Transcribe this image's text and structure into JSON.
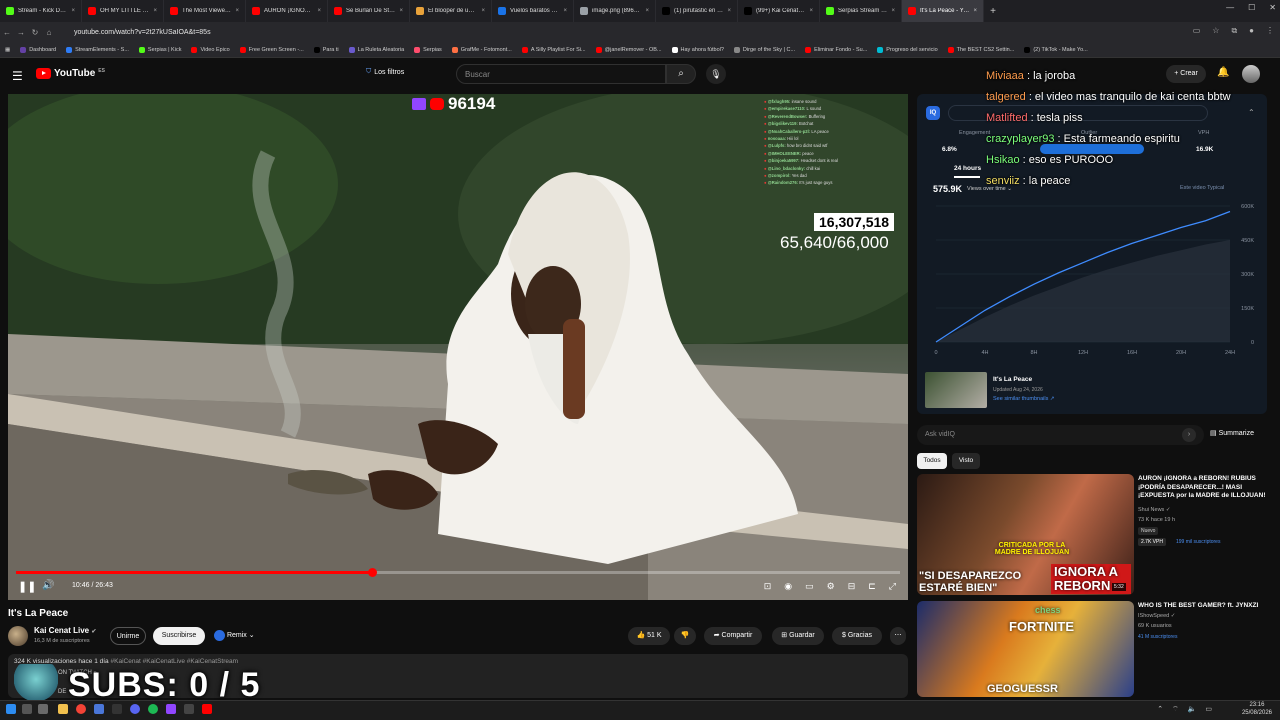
{
  "browser": {
    "tabs": [
      {
        "label": "Stream - Kick Dashbo",
        "color": "#53fc18"
      },
      {
        "label": "OH MY LITTLE BABY B",
        "color": "#ff0000"
      },
      {
        "label": "The Most Viewed VO",
        "color": "#ff0000"
      },
      {
        "label": "AURON ¡IGNORA a RE",
        "color": "#ff0000"
      },
      {
        "label": "Se Burlan De Stream",
        "color": "#ff0000"
      },
      {
        "label": "El blooper de un stre",
        "color": "#e8a23a"
      },
      {
        "label": "Vuelos baratos de Bar",
        "color": "#1a73e8"
      },
      {
        "label": "image.png (896×1024)",
        "color": "#9aa0a6"
      },
      {
        "label": "(1) pirutastic en X: \"so",
        "color": "#000000"
      },
      {
        "label": "(99+) Kai Cenat La Pea",
        "color": "#000000"
      },
      {
        "label": "Serpias Stream - Watc",
        "color": "#53fc18"
      },
      {
        "label": "It's La Peace - YouTu",
        "color": "#ff0000",
        "active": true
      }
    ],
    "url": "youtube.com/watch?v=2t27kUSaIOA&t=85s",
    "bookmarks": [
      {
        "label": "Dashboard",
        "color": "#6441a5"
      },
      {
        "label": "StreamElements - S...",
        "color": "#2e7cf6"
      },
      {
        "label": "Serpias | Kick",
        "color": "#53fc18"
      },
      {
        "label": "Video Epico",
        "color": "#ff0000"
      },
      {
        "label": "Free Green Screen -...",
        "color": "#ff0000"
      },
      {
        "label": "Para ti",
        "color": "#000000"
      },
      {
        "label": "La Ruleta Aleatoria",
        "color": "#6a5acd"
      },
      {
        "label": "Serpias",
        "color": "#ff4d6d"
      },
      {
        "label": "GrafMe - Fotomont...",
        "color": "#ff7043"
      },
      {
        "label": "A Silly Playlist For Si...",
        "color": "#ff0000"
      },
      {
        "label": "@janelRemover - OB...",
        "color": "#ff0000"
      },
      {
        "label": "Hay ahora fútbol?",
        "color": "#ffffff"
      },
      {
        "label": "Dirge of the Sky | C...",
        "color": "#888888"
      },
      {
        "label": "Eliminar Fondo - Su...",
        "color": "#ff0000"
      },
      {
        "label": "Progreso del servicio",
        "color": "#00bcd4"
      },
      {
        "label": "The BEST CS2 Settin...",
        "color": "#ff0000"
      },
      {
        "label": "(2) TikTok - Make Yo...",
        "color": "#000000"
      }
    ]
  },
  "youtube": {
    "logo_text": "YouTube",
    "logo_cc": "ES",
    "filters_label": "Los filtros",
    "search_placeholder": "Buscar",
    "create_label": "Crear"
  },
  "player": {
    "viewer_count": "96194",
    "stat_box": "16,307,518",
    "stat_progress": "65,640/66,000",
    "time": "10:46 / 26:43",
    "progress_fraction": 0.403,
    "chat_overlay": [
      {
        "user": "@fxlugh95:",
        "msg": "insane sound"
      },
      {
        "user": "@empirekase7110:",
        "msg": "L sound"
      },
      {
        "user": "@ReverendBowser:",
        "msg": "Buffering"
      },
      {
        "user": "@bigslikev119:",
        "msg": "Botchat"
      },
      {
        "user": "@NoahCaballero-p2l:",
        "msg": "LA peace"
      },
      {
        "user": "nosoaaa:",
        "msg": "Hiii lol"
      },
      {
        "user": "@Lulpfs:",
        "msg": "how bro didnt said wtf"
      },
      {
        "user": "@IMHOLEENER:",
        "msg": "peace"
      },
      {
        "user": "@binjoeka5997:",
        "msg": "Headset dont is real"
      },
      {
        "user": "@Lino_bdaclonky:",
        "msg": "chill kai"
      },
      {
        "user": "@zompirol:",
        "msg": "Yes dad"
      },
      {
        "user": "@Raindom276:",
        "msg": "It's just sage guys"
      }
    ]
  },
  "video": {
    "title": "It's La Peace",
    "channel": "Kai Cenat Live",
    "channel_subs": "16,3 M de suscriptores",
    "join_label": "Unirme",
    "subscribe_label": "Suscribirse",
    "remix_label": "Remix",
    "likes": "51 K",
    "share_label": "Compartir",
    "save_label": "Guardar",
    "thanks_label": "Gracias",
    "desc_meta": "324 K visualizaciones  hace 1 día",
    "desc_tags": "#KaiCenat #KaiCenatLive #KaiCenatStream",
    "desc_line2": "ON TWITCH »",
    "desc_line3": "DE",
    "subs_overlay": "SUBS: 0 / 5"
  },
  "vidiq": {
    "logo": "IQ",
    "stats_labels": [
      "Engagement",
      "Outlier",
      "VPH"
    ],
    "stats_values": [
      "6.8%",
      "",
      "16.9K"
    ],
    "tab_label": "24 hours",
    "big_views": "575.9K",
    "views_over": "Views over time ⌄",
    "legend": "Este video   Typical",
    "y_ticks": [
      "600K",
      "450K",
      "300K",
      "150K",
      "0"
    ],
    "x_ticks": [
      "0",
      "4H",
      "8H",
      "12H",
      "16H",
      "20H",
      "24H"
    ],
    "ref_title": "It's La Peace",
    "ref_date": "Updated Aug 24, 2026",
    "ref_link": "See similar thumbnails ↗"
  },
  "chart_data": {
    "type": "line",
    "title": "Views over time",
    "x": [
      0,
      2,
      4,
      6,
      8,
      10,
      12,
      14,
      16,
      18,
      20,
      22,
      24
    ],
    "x_tick_labels": [
      "0",
      "4H",
      "8H",
      "12H",
      "16H",
      "20H",
      "24H"
    ],
    "y_tick_labels": [
      "0",
      "150K",
      "300K",
      "450K",
      "600K"
    ],
    "ylim": [
      0,
      600000
    ],
    "xlim": [
      0,
      24
    ],
    "series": [
      {
        "name": "Este video",
        "values": [
          0,
          70000,
          140000,
          200000,
          255000,
          305000,
          350000,
          395000,
          435000,
          470000,
          505000,
          535000,
          575900
        ],
        "color": "#3f8cff"
      },
      {
        "name": "Typical",
        "values": [
          0,
          55000,
          110000,
          160000,
          205000,
          245000,
          285000,
          320000,
          350000,
          380000,
          405000,
          430000,
          450000
        ],
        "color": "#3a4350"
      }
    ]
  },
  "stream_chat": [
    {
      "user": "Miviaaa",
      "msg": " : la joroba",
      "cls": "or"
    },
    {
      "user": "talgered",
      "msg": " : el video mas tranquilo de kai centa bbtw",
      "cls": "or"
    },
    {
      "user": "Matlifted",
      "msg": " : tesla piss",
      "cls": "pk"
    },
    {
      "user": "crazyplayer93",
      "msg": " : Esta farmeando espiritu",
      "cls": ""
    },
    {
      "user": "Hsikao",
      "msg": " : eso es PUROOO",
      "cls": ""
    },
    {
      "user": "senviiz",
      "msg": " : la peace",
      "cls": "yl"
    }
  ],
  "sidebar": {
    "ask_placeholder": "Ask vidIQ",
    "summarize_label": "Summarize",
    "chip_all": "Todos",
    "chip_seen": "Visto",
    "recs": [
      {
        "title": "AURON ¡IGNORA a REBORN! RUBIUS ¡PODRÍA DESAPARECER...! MASI ¡EXPUESTA por la MADRE de ILLOJUAN!",
        "channel": "Shui News ✓",
        "views": "73 K  hace 19 h",
        "badge": "Nuevo",
        "vph": "2.7K VPH",
        "subs": "199 mil suscriptores",
        "duration": "5:32",
        "thumb_text1": "CRITICADA POR LA MADRE DE ILLOJUAN",
        "thumb_text2": "\"SI DESAPAREZCO ESTARÉ BIEN\"",
        "thumb_text3": "IGNORA A REBORN"
      },
      {
        "title": "WHO IS THE BEST GAMER? ft. JYNXZI",
        "channel": "IShowSpeed ✓",
        "views": "69 K usuarios",
        "subs": "41 M suscriptores",
        "thumb_text1": "chess",
        "thumb_text2": "FORTNITE",
        "thumb_text3": "GEOGUESSR"
      }
    ]
  },
  "taskbar": {
    "time": "23:16",
    "date": "25/08/2026"
  }
}
